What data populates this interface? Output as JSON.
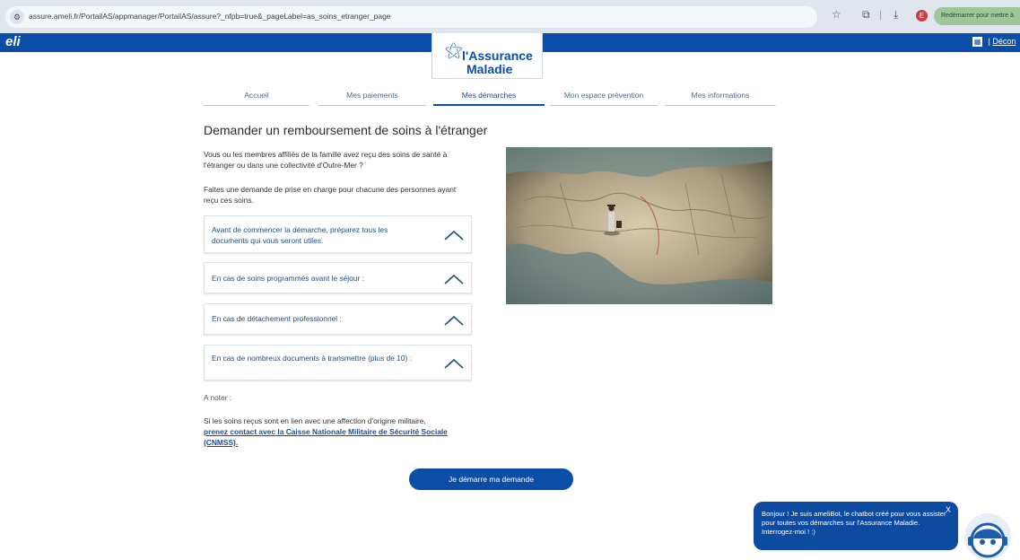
{
  "browser": {
    "url": "assure.ameli.fr/PortailAS/appmanager/PortailAS/assure?_nfpb=true&_pageLabel=as_soins_etranger_page",
    "profile_initial": "E",
    "restart_label": "Redémarrer pour mettre à"
  },
  "header": {
    "brand_fragment": "eli",
    "logo_line1": "l'Assurance",
    "logo_line2": "Maladie",
    "logout_label": "Décon"
  },
  "nav": {
    "tabs": [
      {
        "label": "Accueil",
        "active": false
      },
      {
        "label": "Mes paiements",
        "active": false
      },
      {
        "label": "Mes démarches",
        "active": true
      },
      {
        "label": "Mon espace prévention",
        "active": false
      },
      {
        "label": "Mes informations",
        "active": false
      }
    ]
  },
  "main": {
    "title": "Demander un remboursement de soins à l'étranger",
    "intro1": "Vous ou les membres affiliés de la famille avez reçu des soins de santé à l'étranger ou dans une collectivité d'Outre-Mer ?",
    "intro2": "Faites une demande de prise en charge pour chacune des personnes ayant reçu ces soins.",
    "accordions": [
      {
        "label": "Avant de commencer la démarche, préparez tous les documents qui vous seront utiles."
      },
      {
        "label": "En cas de soins programmés avant le séjour :"
      },
      {
        "label": "En cas de détachement professionnel :"
      },
      {
        "label": "En cas de nombreux documents à transmettre (plus de 10) :"
      }
    ],
    "note_heading": "A noter :",
    "note_text": "Si les soins reçus sont en lien avec une affection d'origine militaire,",
    "note_link": "prenez contact avec la Caisse Nationale Militaire de Sécurité Sociale (CNMSS).",
    "cta_label": "Je démarre ma demande"
  },
  "chatbot": {
    "message": "Bonjour ! Je suis ameliBot, le chatbot créé pour vous assister pour toutes vos démarches sur l'Assurance Maladie. Interrogez-moi ! :)",
    "close_label": "X"
  },
  "colors": {
    "brand_blue": "#0b4ea8",
    "link_blue": "#1f4d85",
    "browser_bar": "#dfe6ee"
  }
}
